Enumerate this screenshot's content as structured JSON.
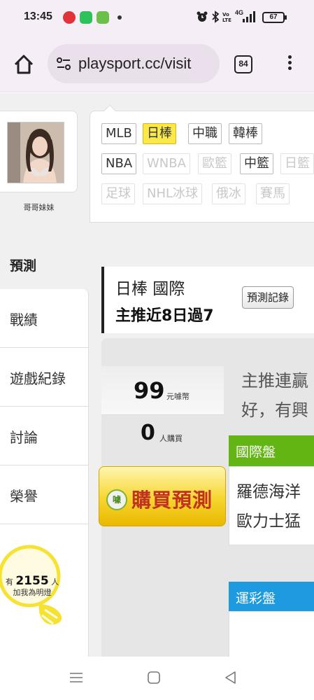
{
  "status_bar": {
    "time": "13:45",
    "network": "4G",
    "battery": "67"
  },
  "browser": {
    "url": "playsport.cc/visit",
    "tab_count": "84"
  },
  "profile": {
    "username": "哥哥妹妹"
  },
  "sport_tabs": [
    {
      "label": "MLB",
      "state": "normal"
    },
    {
      "label": "日棒",
      "state": "active"
    },
    {
      "label": "中職",
      "state": "normal"
    },
    {
      "label": "韓棒",
      "state": "normal"
    },
    {
      "label": "NBA",
      "state": "normal"
    },
    {
      "label": "WNBA",
      "state": "disabled"
    },
    {
      "label": "歐籃",
      "state": "disabled"
    },
    {
      "label": "中籃",
      "state": "normal"
    },
    {
      "label": "日籃",
      "state": "disabled"
    },
    {
      "label": "足球",
      "state": "disabled"
    },
    {
      "label": "NHL冰球",
      "state": "disabled"
    },
    {
      "label": "俄冰",
      "state": "disabled"
    },
    {
      "label": "賽馬",
      "state": "disabled"
    }
  ],
  "left_nav": {
    "active": "預測",
    "items": [
      "戰績",
      "遊戲紀錄",
      "討論",
      "榮譽"
    ]
  },
  "fans": {
    "prefix": "有",
    "count": "2155",
    "suffix": "人",
    "caption": "加我為明燈"
  },
  "prediction": {
    "sport_line": "日棒 國際",
    "streak": "主推近8日過7",
    "record_button": "預測記錄",
    "price": "99",
    "price_unit": "元噱幣",
    "buyers": "0",
    "buyers_unit": "人購買",
    "buy_icon": "噱",
    "buy_button": "購買預測",
    "desc_line1": "主推連贏",
    "desc_line2": "好，有興",
    "intl_section": "國際盤",
    "match_line1": "羅德海洋",
    "match_line2": "歐力士猛",
    "lottery_section": "運彩盤"
  },
  "colors": {
    "active_tab": "#fbe84b",
    "intl_header": "#62b513",
    "lottery_header": "#1d9ae0",
    "buy_button_text": "#c0311f"
  }
}
